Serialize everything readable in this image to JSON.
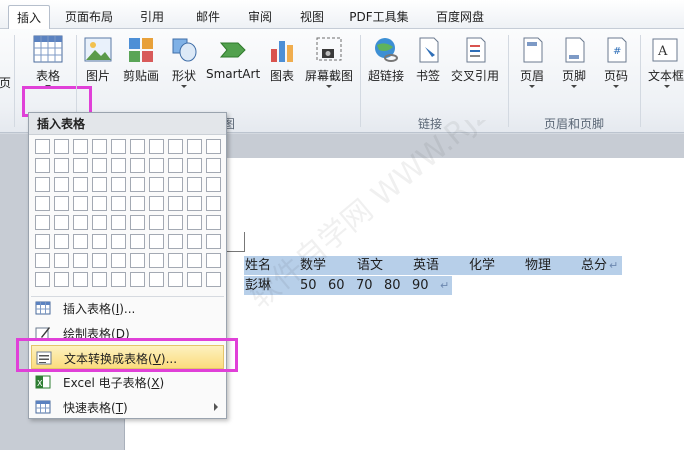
{
  "tabs": [
    {
      "label": "插入",
      "active": true
    },
    {
      "label": "页面布局"
    },
    {
      "label": "引用"
    },
    {
      "label": "邮件"
    },
    {
      "label": "审阅"
    },
    {
      "label": "视图"
    },
    {
      "label": "PDF工具集"
    },
    {
      "label": "百度网盘"
    }
  ],
  "ribbon": {
    "page_fragment": "页",
    "table": "表格",
    "picture": "图片",
    "clipart": "剪贴画",
    "shapes": "形状",
    "smartart": "SmartArt",
    "chart": "图表",
    "screenshot": "屏幕截图",
    "hyperlink": "超链接",
    "bookmark": "书签",
    "crossref": "交叉引用",
    "header": "页眉",
    "footer": "页脚",
    "pagenum": "页码",
    "textbox": "文本框",
    "group_links": "链接",
    "group_header_footer": "页眉和页脚",
    "group_fragment": "图"
  },
  "dropdown": {
    "title": "插入表格",
    "items": [
      {
        "label": "插入表格(",
        "key": "I",
        "suffix": ")..."
      },
      {
        "label": "绘制表格(",
        "key": "D",
        "suffix": ")"
      },
      {
        "label": "文本转换成表格(",
        "key": "V",
        "suffix": ")..."
      },
      {
        "label": "Excel 电子表格(",
        "key": "X",
        "suffix": ")"
      },
      {
        "label": "快速表格(",
        "key": "T",
        "suffix": ")"
      }
    ]
  },
  "document": {
    "headers": [
      "姓名",
      "数学",
      "语文",
      "英语",
      "化学",
      "物理",
      "总分"
    ],
    "row": [
      "彭琳",
      "50",
      "60",
      "70",
      "80",
      "90"
    ],
    "pilcrow": "↵"
  },
  "watermark": "软件自学网 WWW.RJZXW.COM",
  "colors": {
    "highlight": "#e040d8",
    "selection": "#b7cfe9",
    "menu_hover": "#fbdc7d"
  }
}
